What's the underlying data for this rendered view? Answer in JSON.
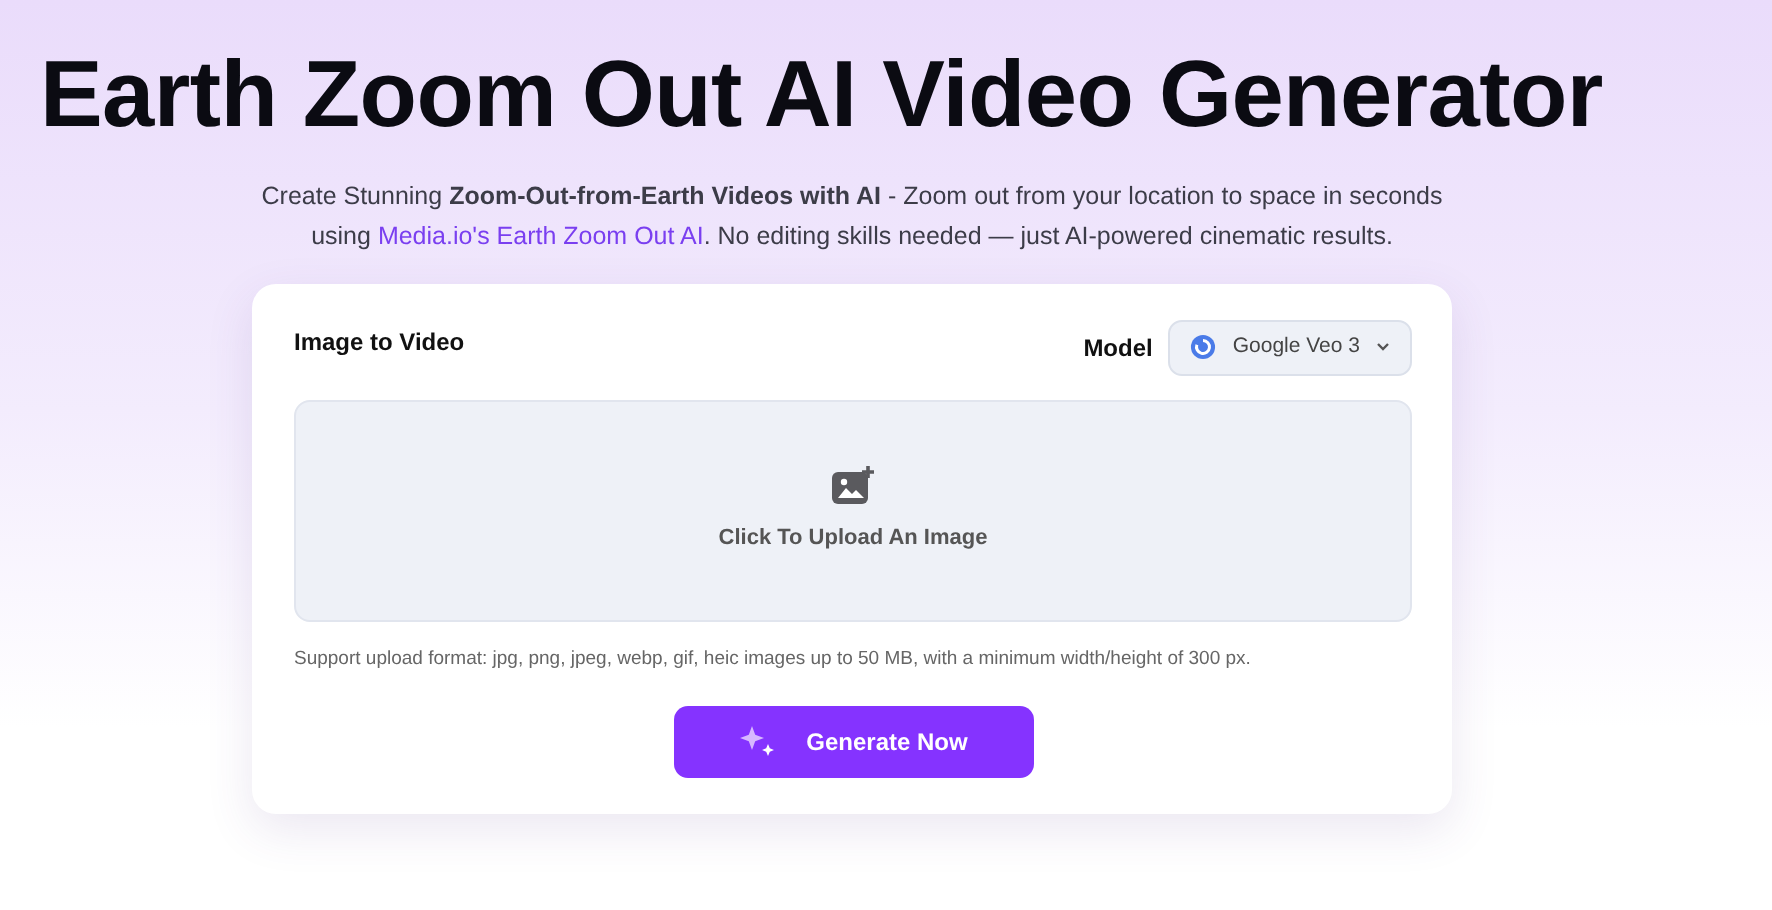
{
  "title": "Earth Zoom Out AI Video Generator",
  "intro": {
    "before": "Create Stunning **Zoom-Out-from-Earth Videos with AI** - Zoom out from your location to space in seconds using ",
    "link": "Media.io's Earth Zoom Out AI",
    "after": ". No editing skills needed — just AI-powered cinematic results."
  },
  "card": {
    "heading": "Image to Video",
    "model_label": "Model",
    "model_value": "Google Veo 3",
    "upload": {
      "label": "Click To Upload An Image"
    },
    "note": "Support upload format: jpg, png, jpeg, webp, gif, heic images up to 50 MB, with a minimum width/height of 300 px.",
    "button": "Generate Now"
  }
}
